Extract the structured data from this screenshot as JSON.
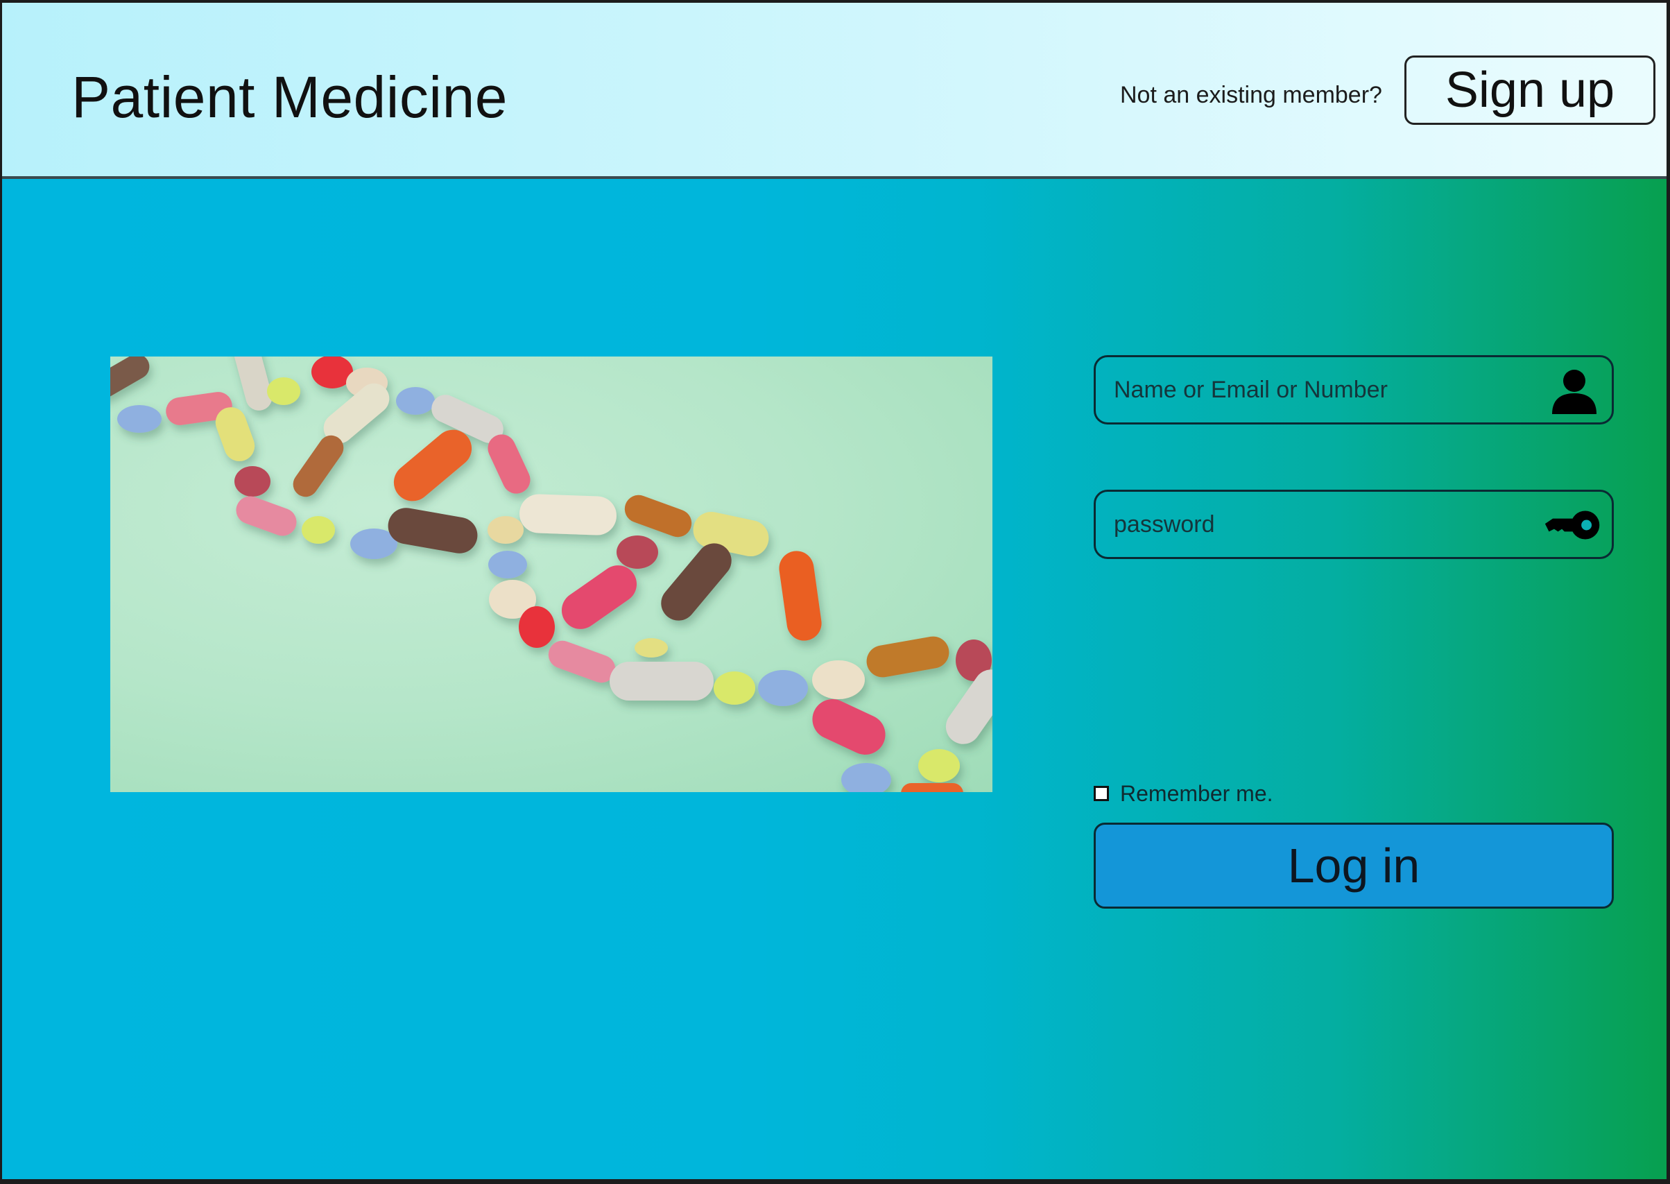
{
  "header": {
    "title": "Patient Medicine",
    "not_member_text": "Not an existing member?",
    "signup_label": "Sign up"
  },
  "login": {
    "username_placeholder": "Name or Email or Number",
    "password_placeholder": "password",
    "remember_label": "Remember me.",
    "login_label": "Log in",
    "remember_checked": false
  },
  "icons": {
    "username": "user-icon",
    "password": "key-icon"
  },
  "colors": {
    "header_bg": "#c8f4fc",
    "main_bg_start": "#00b6de",
    "main_bg_end": "#07a04f",
    "login_button": "#1496d8"
  }
}
